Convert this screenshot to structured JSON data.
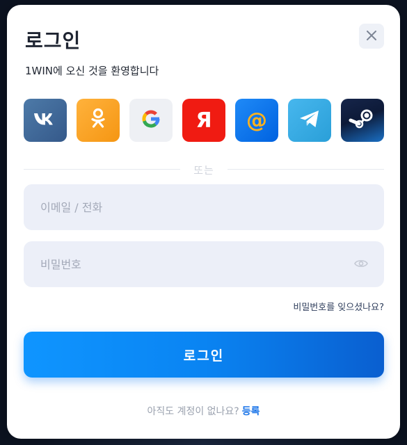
{
  "modal": {
    "title": "로그인",
    "subtitle": "1WIN에 오신 것을 환영합니다",
    "close_icon": "close-icon"
  },
  "socials": [
    {
      "name": "vk",
      "icon": "vk-icon",
      "label": "VK",
      "color": "#4d7aa8"
    },
    {
      "name": "ok",
      "icon": "odnoklassniki-icon",
      "color": "#f7a11c"
    },
    {
      "name": "google",
      "icon": "google-icon",
      "label": "G",
      "color": "#eef0f4"
    },
    {
      "name": "yandex",
      "icon": "yandex-icon",
      "label": "Я",
      "color": "#f01b12"
    },
    {
      "name": "mail",
      "icon": "mail-at-icon",
      "label": "@",
      "color": "#1f8af7"
    },
    {
      "name": "telegram",
      "icon": "telegram-icon",
      "color": "#38abe3"
    },
    {
      "name": "steam",
      "icon": "steam-icon",
      "color": "#16254a"
    }
  ],
  "divider": {
    "text": "또는"
  },
  "form": {
    "email_placeholder": "이메일 / 전화",
    "email_value": "",
    "password_placeholder": "비밀번호",
    "password_value": "",
    "forgot_label": "비밀번호를 잊으셨나요?",
    "submit_label": "로그인"
  },
  "footer": {
    "prompt": "아직도 계정이 없나요?",
    "register_label": "등록"
  },
  "colors": {
    "accent": "#0a84f2",
    "field_bg": "#eceff8",
    "link": "#1a74e8"
  }
}
